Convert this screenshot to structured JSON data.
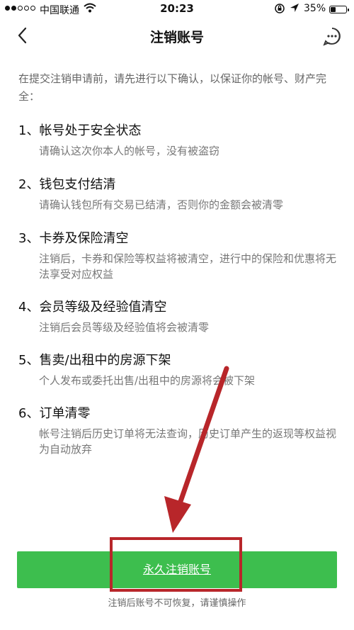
{
  "status_bar": {
    "carrier": "中国联通",
    "time": "20:23",
    "battery_percent_label": "35%",
    "battery_level": 0.35
  },
  "nav": {
    "title": "注销账号",
    "back_icon": "chevron-left-icon",
    "more_icon": "more-dots-icon"
  },
  "intro": "在提交注销申请前，请先进行以下确认，以保证你的帐号、财产完全：",
  "items": [
    {
      "title": "1、帐号处于安全状态",
      "desc": "请确认这次你本人的帐号，没有被盗窃"
    },
    {
      "title": "2、钱包支付结清",
      "desc": "请确认钱包所有交易已结清，否则你的金额会被清零"
    },
    {
      "title": "3、卡券及保险清空",
      "desc": "注销后，卡券和保险等权益将被清空，进行中的保险和优惠将无法享受对应权益"
    },
    {
      "title": "4、会员等级及经验值清空",
      "desc": "注销后会员等级及经验值将会被清零"
    },
    {
      "title": "5、售卖/出租中的房源下架",
      "desc": "个人发布或委托出售/出租中的房源将会被下架"
    },
    {
      "title": "6、订单清零",
      "desc": "帐号注销后历史订单将无法查询，历史订单产生的返现等权益视为自动放弃"
    }
  ],
  "confirm_button": "永久注销账号",
  "footnote": "注销后账号不可恢复，请谨慎操作",
  "colors": {
    "button_green": "#3dbe4e",
    "annotation_red": "#b8262a"
  }
}
